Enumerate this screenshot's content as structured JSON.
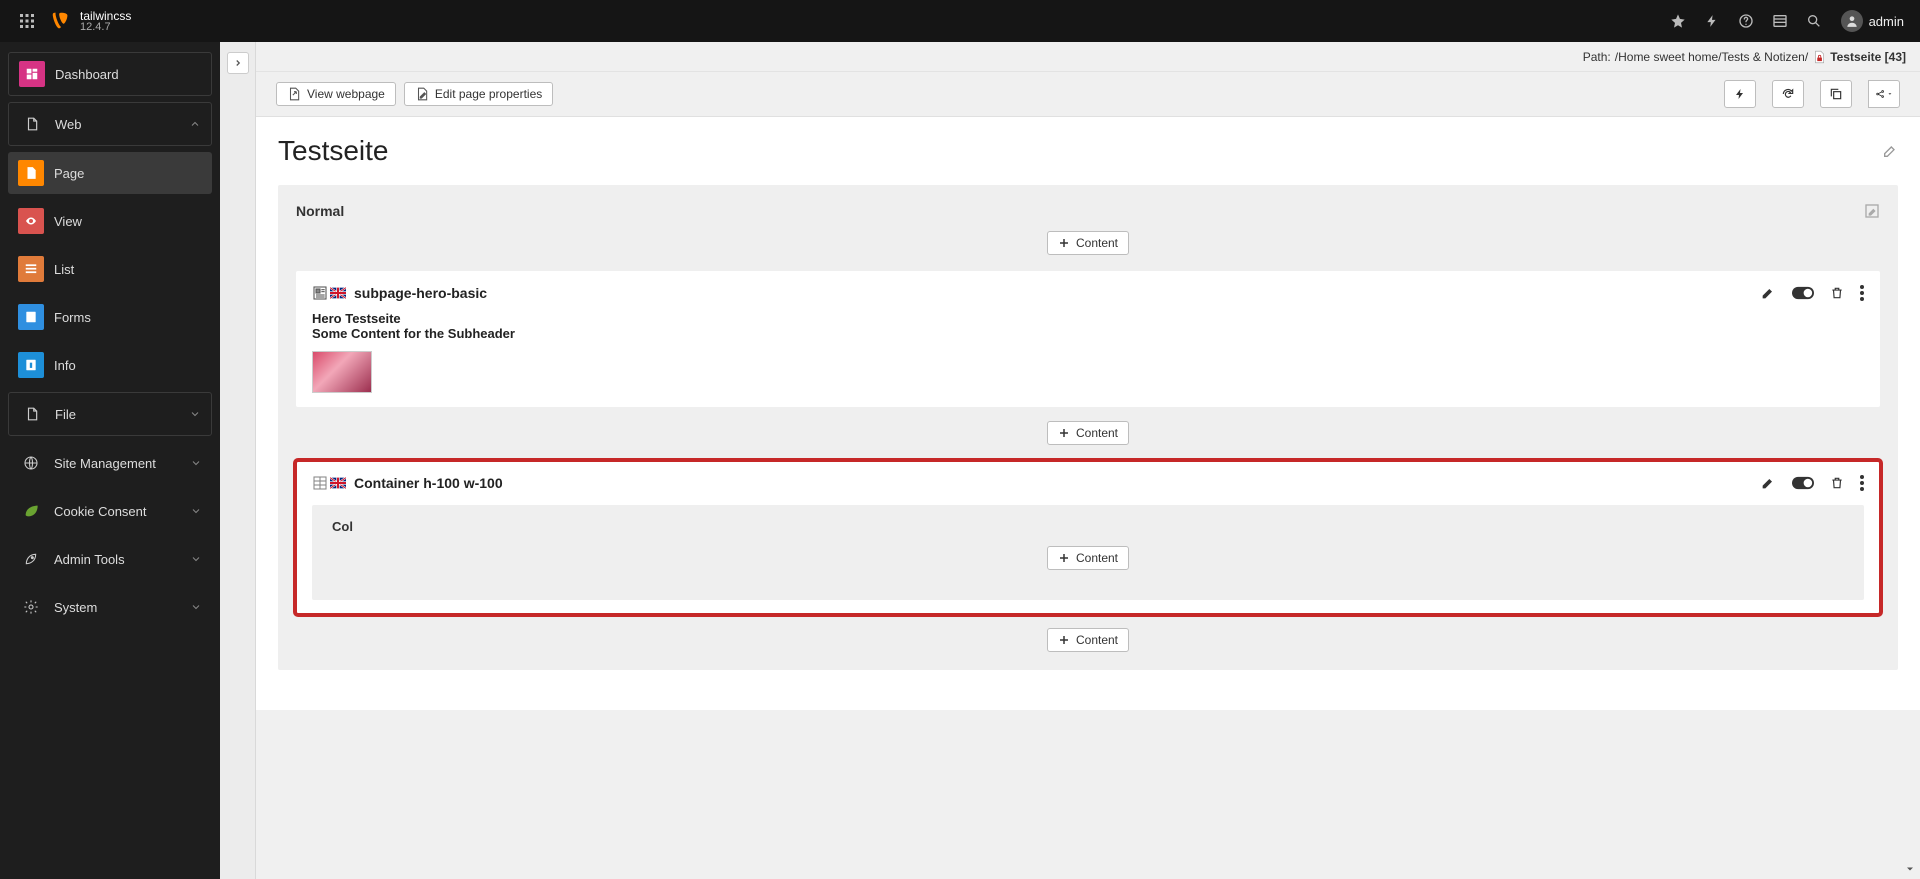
{
  "topbar": {
    "site_name": "tailwincss",
    "version": "12.4.7",
    "user_name": "admin"
  },
  "sidebar": {
    "dashboard": "Dashboard",
    "web": "Web",
    "page": "Page",
    "view": "View",
    "list": "List",
    "forms": "Forms",
    "info": "Info",
    "file": "File",
    "site_management": "Site Management",
    "cookie_consent": "Cookie Consent",
    "admin_tools": "Admin Tools",
    "system": "System"
  },
  "docheader": {
    "path_label": "Path: ",
    "path_value": "/Home sweet home/Tests & Notizen/",
    "page_name": "Testseite [43]",
    "view_webpage": "View webpage",
    "edit_page_props": "Edit page properties"
  },
  "page": {
    "title": "Testseite"
  },
  "zone": {
    "title": "Normal",
    "add_content": "Content"
  },
  "ce1": {
    "title": "subpage-hero-basic",
    "line1": "Hero Testseite",
    "line2": "Some Content for the Subheader"
  },
  "ce2": {
    "title": "Container h-100 w-100",
    "col_label": "Col"
  }
}
